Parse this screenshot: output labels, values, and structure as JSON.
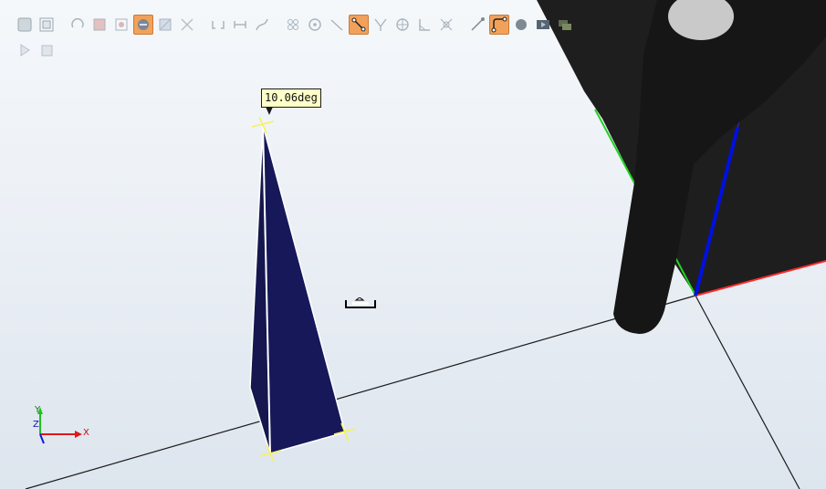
{
  "viewport": {
    "measurement_tooltip": "10.06deg"
  },
  "triad": {
    "x_label": "X",
    "y_label": "Y",
    "z_label": "Z"
  },
  "toolbar": {
    "row1": [
      {
        "name": "shaded-view-icon",
        "active": false
      },
      {
        "name": "wireframe-view-icon",
        "active": false
      },
      {
        "name": "rotate-view-icon",
        "active": false
      },
      {
        "name": "select-part-icon",
        "active": false
      },
      {
        "name": "select-frame-icon",
        "active": false
      },
      {
        "name": "select-target-icon",
        "active": true
      },
      {
        "name": "select-path-icon",
        "active": false
      },
      {
        "name": "select-group-icon",
        "active": false
      },
      {
        "name": "snap-object-icon",
        "active": false
      },
      {
        "name": "snap-edge-icon",
        "active": false
      },
      {
        "name": "snap-path-icon",
        "active": false
      },
      {
        "name": "snap-grid-icon",
        "active": false
      },
      {
        "name": "snap-center-icon",
        "active": false
      },
      {
        "name": "snap-end-icon",
        "active": false
      },
      {
        "name": "measure-distance-icon",
        "active": true
      },
      {
        "name": "measure-angle-icon",
        "active": false
      },
      {
        "name": "measure-diameter-icon",
        "active": false
      },
      {
        "name": "measure-frame-icon",
        "active": false
      },
      {
        "name": "measure-shortest-icon",
        "active": false
      },
      {
        "name": "point-to-point-icon",
        "active": false
      },
      {
        "name": "measure-arc-icon",
        "active": true
      },
      {
        "name": "record-icon",
        "active": false
      },
      {
        "name": "media-icon",
        "active": false
      },
      {
        "name": "layers-icon",
        "active": false
      }
    ],
    "row2": [
      {
        "name": "play-icon",
        "active": false
      },
      {
        "name": "stop-icon",
        "active": false
      }
    ]
  }
}
